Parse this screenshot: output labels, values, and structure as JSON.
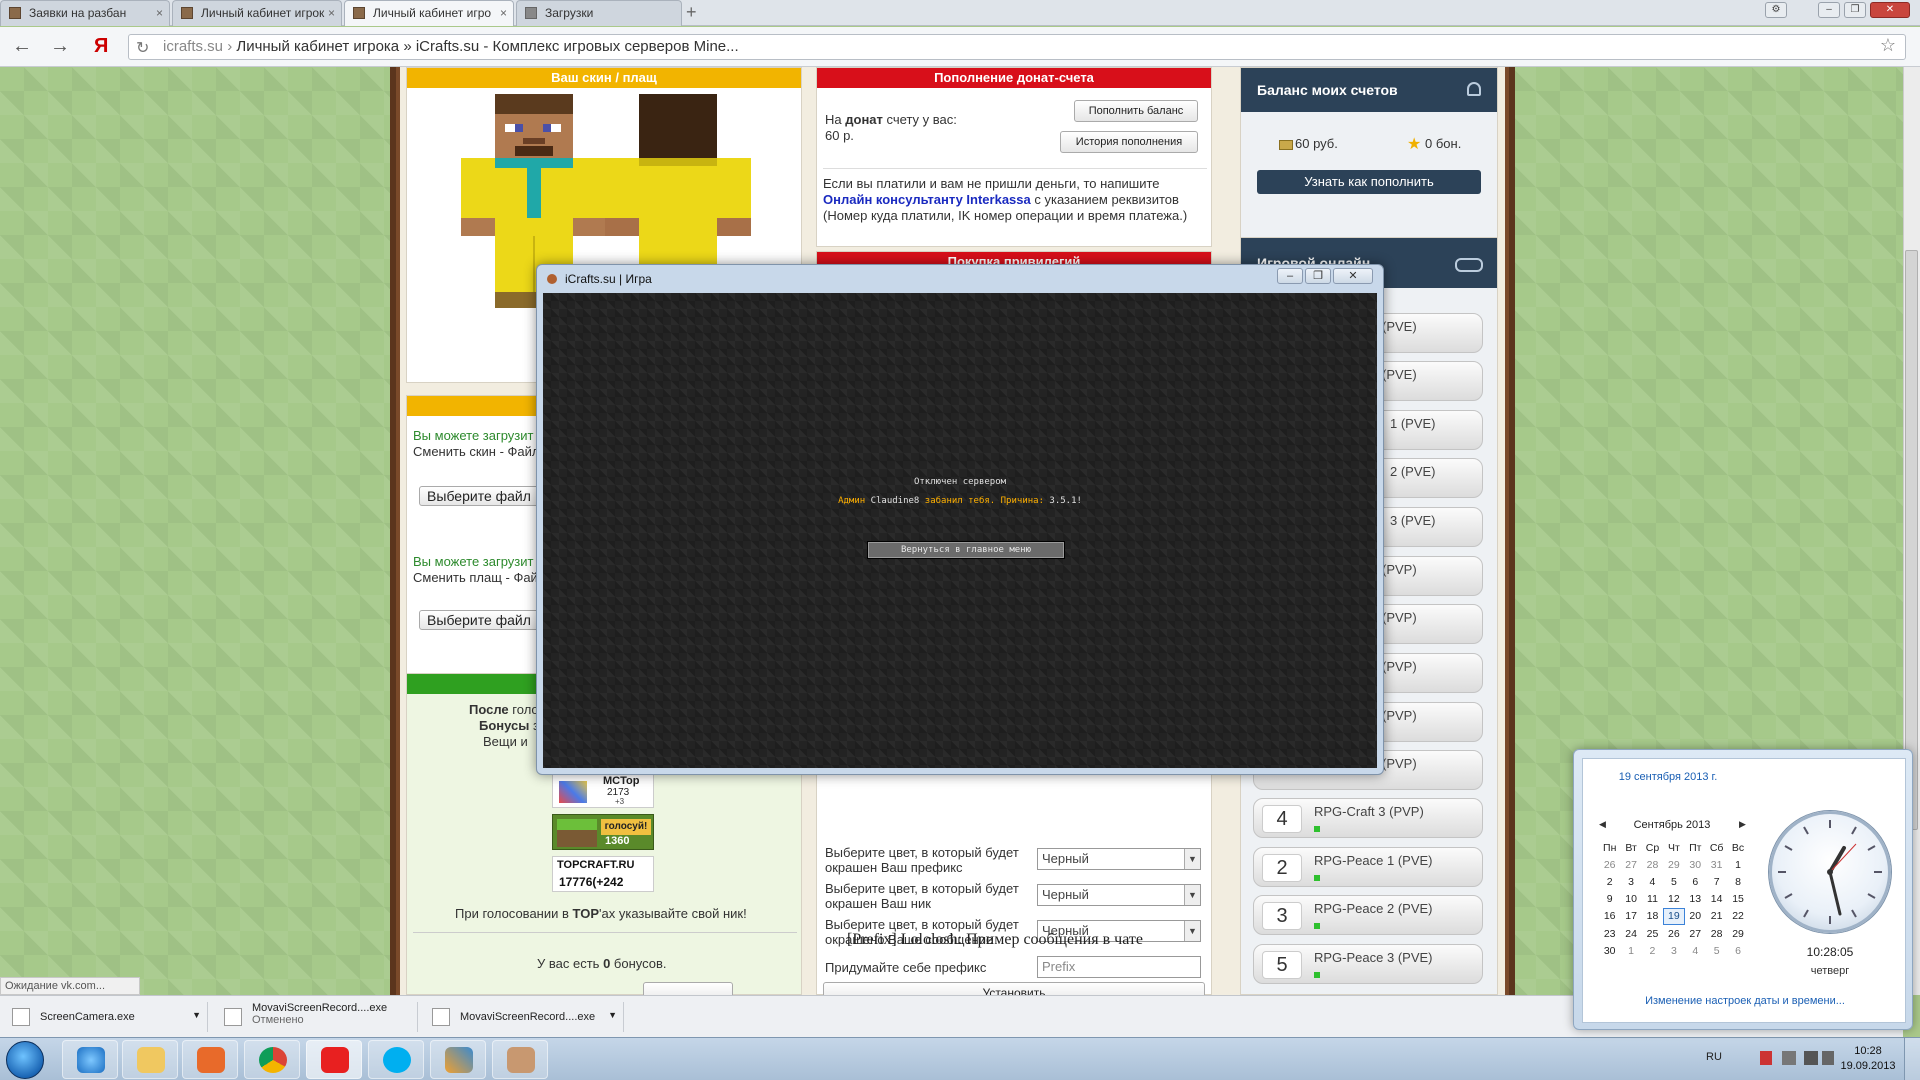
{
  "browser": {
    "tabs": [
      {
        "label": "Заявки на разбан",
        "active": false
      },
      {
        "label": "Личный кабинет игрок",
        "active": false
      },
      {
        "label": "Личный кабинет игро",
        "active": true
      },
      {
        "label": "Загрузки",
        "active": false
      }
    ],
    "new_tab": "+",
    "url_host": "icrafts.su",
    "url_sep": "›",
    "url_title": "Личный кабинет игрока » iCrafts.su - Комплекс игровых серверов Mine...",
    "yandex_letter": "Я"
  },
  "skin_panel": {
    "title": "Ваш скин / плащ",
    "upload_text_skin": "Вы можете загрузит",
    "change_skin": "Сменить скин - Файл",
    "choose_file_1": "Выберите файл",
    "upload_text_cloak": "Вы можете загрузит",
    "change_cloak": "Сменить плащ - Фай",
    "choose_file_2": "Выберите файл",
    "bonus_line1_a": "После",
    "bonus_line1_b": "голо",
    "bonus_line2_a": "Бонусы",
    "bonus_line2_b": "з",
    "bonus_line3": "Вещи и",
    "mctop_name": "MCTop",
    "mctop_count": "2173",
    "mctop_delta": "+3",
    "vote_label": "голосуй!",
    "vote_count": "1360",
    "topcraft_name": "TOPCRAFT.RU",
    "topcraft_count": "17776(+242",
    "vote_hint_a": "При голосовании в",
    "vote_hint_b": "TOP",
    "vote_hint_c": "'ах указывайте свой ник!",
    "bonus_have_a": "У вас есть",
    "bonus_have_b": "0",
    "bonus_have_c": "бонусов."
  },
  "donate_panel": {
    "title": "Пополнение донат-счета",
    "on_label_a": "На",
    "on_label_b": "донат",
    "on_label_c": "счету у вас:",
    "amount": "60 р.",
    "topup_button": "Пополнить баланс",
    "history_button": "История пополнения",
    "help_line1": "Если вы платили и вам не пришли деньги, то напишите",
    "help_link": "Онлайн консультанту Interkassa",
    "help_line2_rest": "с указанием реквизитов",
    "help_line3": "(Номер куда платили, IK номер операции и время платежа.)",
    "privileges_title": "Покупка привилегий",
    "prefix_color_label_1": "Выберите цвет, в который будет",
    "prefix_color_label_2": "окрашен Ваш префикс",
    "nick_color_label_1": "Выберите цвет, в который будет",
    "nick_color_label_2": "окрашен Ваш ник",
    "msg_color_label_1": "Выберите цвет, в который будет",
    "msg_color_label_2": "окрашено Ваше сообщение",
    "color_value": "Черный",
    "prefix_label": "Придумайте себе префикс",
    "prefix_placeholder": "Prefix",
    "preview": "[Prefix] Lololosh: Пример сообщения в чате",
    "install_button": "Установить"
  },
  "balance_panel": {
    "title": "Баланс моих счетов",
    "rub": "60 руб.",
    "bonus": "0 бон.",
    "how_button": "Узнать как пополнить",
    "online_title": "Игровой онлайн"
  },
  "servers": [
    {
      "num": "",
      "name": "(PVE)"
    },
    {
      "num": "",
      "name": "(PVE)"
    },
    {
      "num": "",
      "name": "1 (PVE)"
    },
    {
      "num": "",
      "name": "2 (PVE)"
    },
    {
      "num": "",
      "name": "3 (PVE)"
    },
    {
      "num": "",
      "name": "(PVP)"
    },
    {
      "num": "",
      "name": "(PVP)"
    },
    {
      "num": "",
      "name": "(PVP)"
    },
    {
      "num": "",
      "name": "(PVP)"
    },
    {
      "num": "",
      "name": "(PVP)"
    },
    {
      "num": "4",
      "name": "RPG-Craft 3 (PVP)"
    },
    {
      "num": "2",
      "name": "RPG-Peace 1 (PVE)"
    },
    {
      "num": "3",
      "name": "RPG-Peace 2 (PVE)"
    },
    {
      "num": "5",
      "name": "RPG-Peace 3 (PVE)"
    }
  ],
  "game_window": {
    "title": "iCrafts.su | Игра",
    "disconnected": "Отключен сервером",
    "ban_a": "Админ",
    "ban_b": "Claudine8",
    "ban_c": "забанил тебя. Причина:",
    "ban_d": "3.5.1!",
    "menu_button": "Вернуться в главное меню",
    "colors": {
      "ban_accent": "#ffb000",
      "ban_name": "#e0e0e0"
    }
  },
  "status_text": "Ожидание vk.com...",
  "downloads": [
    {
      "name": "ScreenCamera.exe",
      "sub": ""
    },
    {
      "name": "MovaviScreenRecord....exe",
      "sub": "Отменено"
    },
    {
      "name": "MovaviScreenRecord....exe",
      "sub": ""
    }
  ],
  "tray": {
    "lang": "RU",
    "time": "10:28",
    "date": "19.09.2013"
  },
  "calendar": {
    "date_long": "19 сентября 2013 г.",
    "month": "Сентябрь 2013",
    "weekdays": [
      "Пн",
      "Вт",
      "Ср",
      "Чт",
      "Пт",
      "Сб",
      "Вс"
    ],
    "days": [
      [
        "26",
        "27",
        "28",
        "29",
        "30",
        "31",
        "1"
      ],
      [
        "2",
        "3",
        "4",
        "5",
        "6",
        "7",
        "8"
      ],
      [
        "9",
        "10",
        "11",
        "12",
        "13",
        "14",
        "15"
      ],
      [
        "16",
        "17",
        "18",
        "19",
        "20",
        "21",
        "22"
      ],
      [
        "23",
        "24",
        "25",
        "26",
        "27",
        "28",
        "29"
      ],
      [
        "30",
        "1",
        "2",
        "3",
        "4",
        "5",
        "6"
      ]
    ],
    "today": "19",
    "time": "10:28:05",
    "weekday": "четверг",
    "settings_link": "Изменение настроек даты и времени..."
  }
}
